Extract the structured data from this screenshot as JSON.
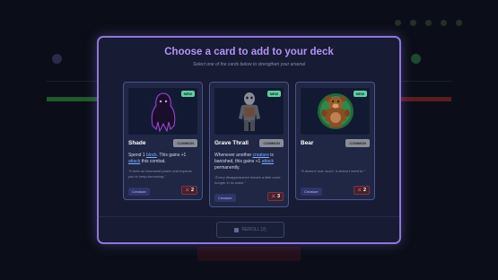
{
  "background": {
    "title": "",
    "label": "",
    "player_left": "",
    "player_right": "",
    "health_label": "",
    "health_value": "",
    "bottom_button": ""
  },
  "modal": {
    "title": "Choose a card to add to your deck",
    "subtitle": "Select one of the cards below to strengthen your arsenal",
    "reroll_label": "REROLL (2)"
  },
  "cards": [
    {
      "badge": "NEW",
      "name": "Shade",
      "rarity": "COMMON",
      "desc_parts": [
        "Spend 1 ",
        "block",
        ". This gains +1 ",
        "attack",
        " this combat."
      ],
      "flavor": "\"It lives on borrowed power and expects you to keep borrowing.\"",
      "tag": "Creature",
      "power": "2",
      "icon": "shade-icon"
    },
    {
      "badge": "NEW",
      "name": "Grave Thrall",
      "rarity": "COMMON",
      "desc_parts": [
        "Whenever another ",
        "creature",
        " is banished, this gains +1 ",
        "attack",
        " permanently."
      ],
      "flavor": "\"Every disappearance leaves a little more hunger in its wake.\"",
      "tag": "Creature",
      "power": "3",
      "icon": "ghoul-icon"
    },
    {
      "badge": "NEW",
      "name": "Bear",
      "rarity": "COMMON",
      "desc_parts": [],
      "flavor": "\"It doesn't roar much. It doesn't need to.\"",
      "tag": "Creature",
      "power": "2",
      "icon": "bear-icon"
    }
  ]
}
